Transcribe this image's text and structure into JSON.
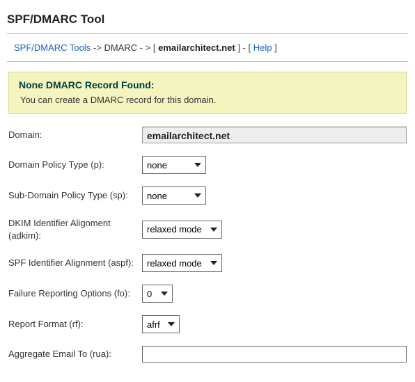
{
  "title": "SPF/DMARC Tool",
  "breadcrumb": {
    "root_label": "SPF/DMARC Tools",
    "sep1": " -> ",
    "item2": "DMARC",
    "sep2": " - > [ ",
    "domain": "emailarchitect.net",
    "sep3": " ] - [ ",
    "help_label": "Help",
    "sep4": " ]"
  },
  "notice": {
    "title": "None DMARC Record Found:",
    "body": "You can create a DMARC record for this domain."
  },
  "form": {
    "domain": {
      "label": "Domain:",
      "value": "emailarchitect.net"
    },
    "p": {
      "label": "Domain Policy Type (p):",
      "value": "none"
    },
    "sp": {
      "label": "Sub-Domain Policy Type (sp):",
      "value": "none"
    },
    "adkim": {
      "label": "DKIM Identifier Alignment (adkim):",
      "value": "relaxed mode"
    },
    "aspf": {
      "label": "SPF Identifier Alignment (aspf):",
      "value": "relaxed mode"
    },
    "fo": {
      "label": "Failure Reporting Options (fo):",
      "value": "0"
    },
    "rf": {
      "label": "Report Format (rf):",
      "value": "afrf"
    },
    "rua": {
      "label": "Aggregate Email To (rua):",
      "value": ""
    }
  }
}
